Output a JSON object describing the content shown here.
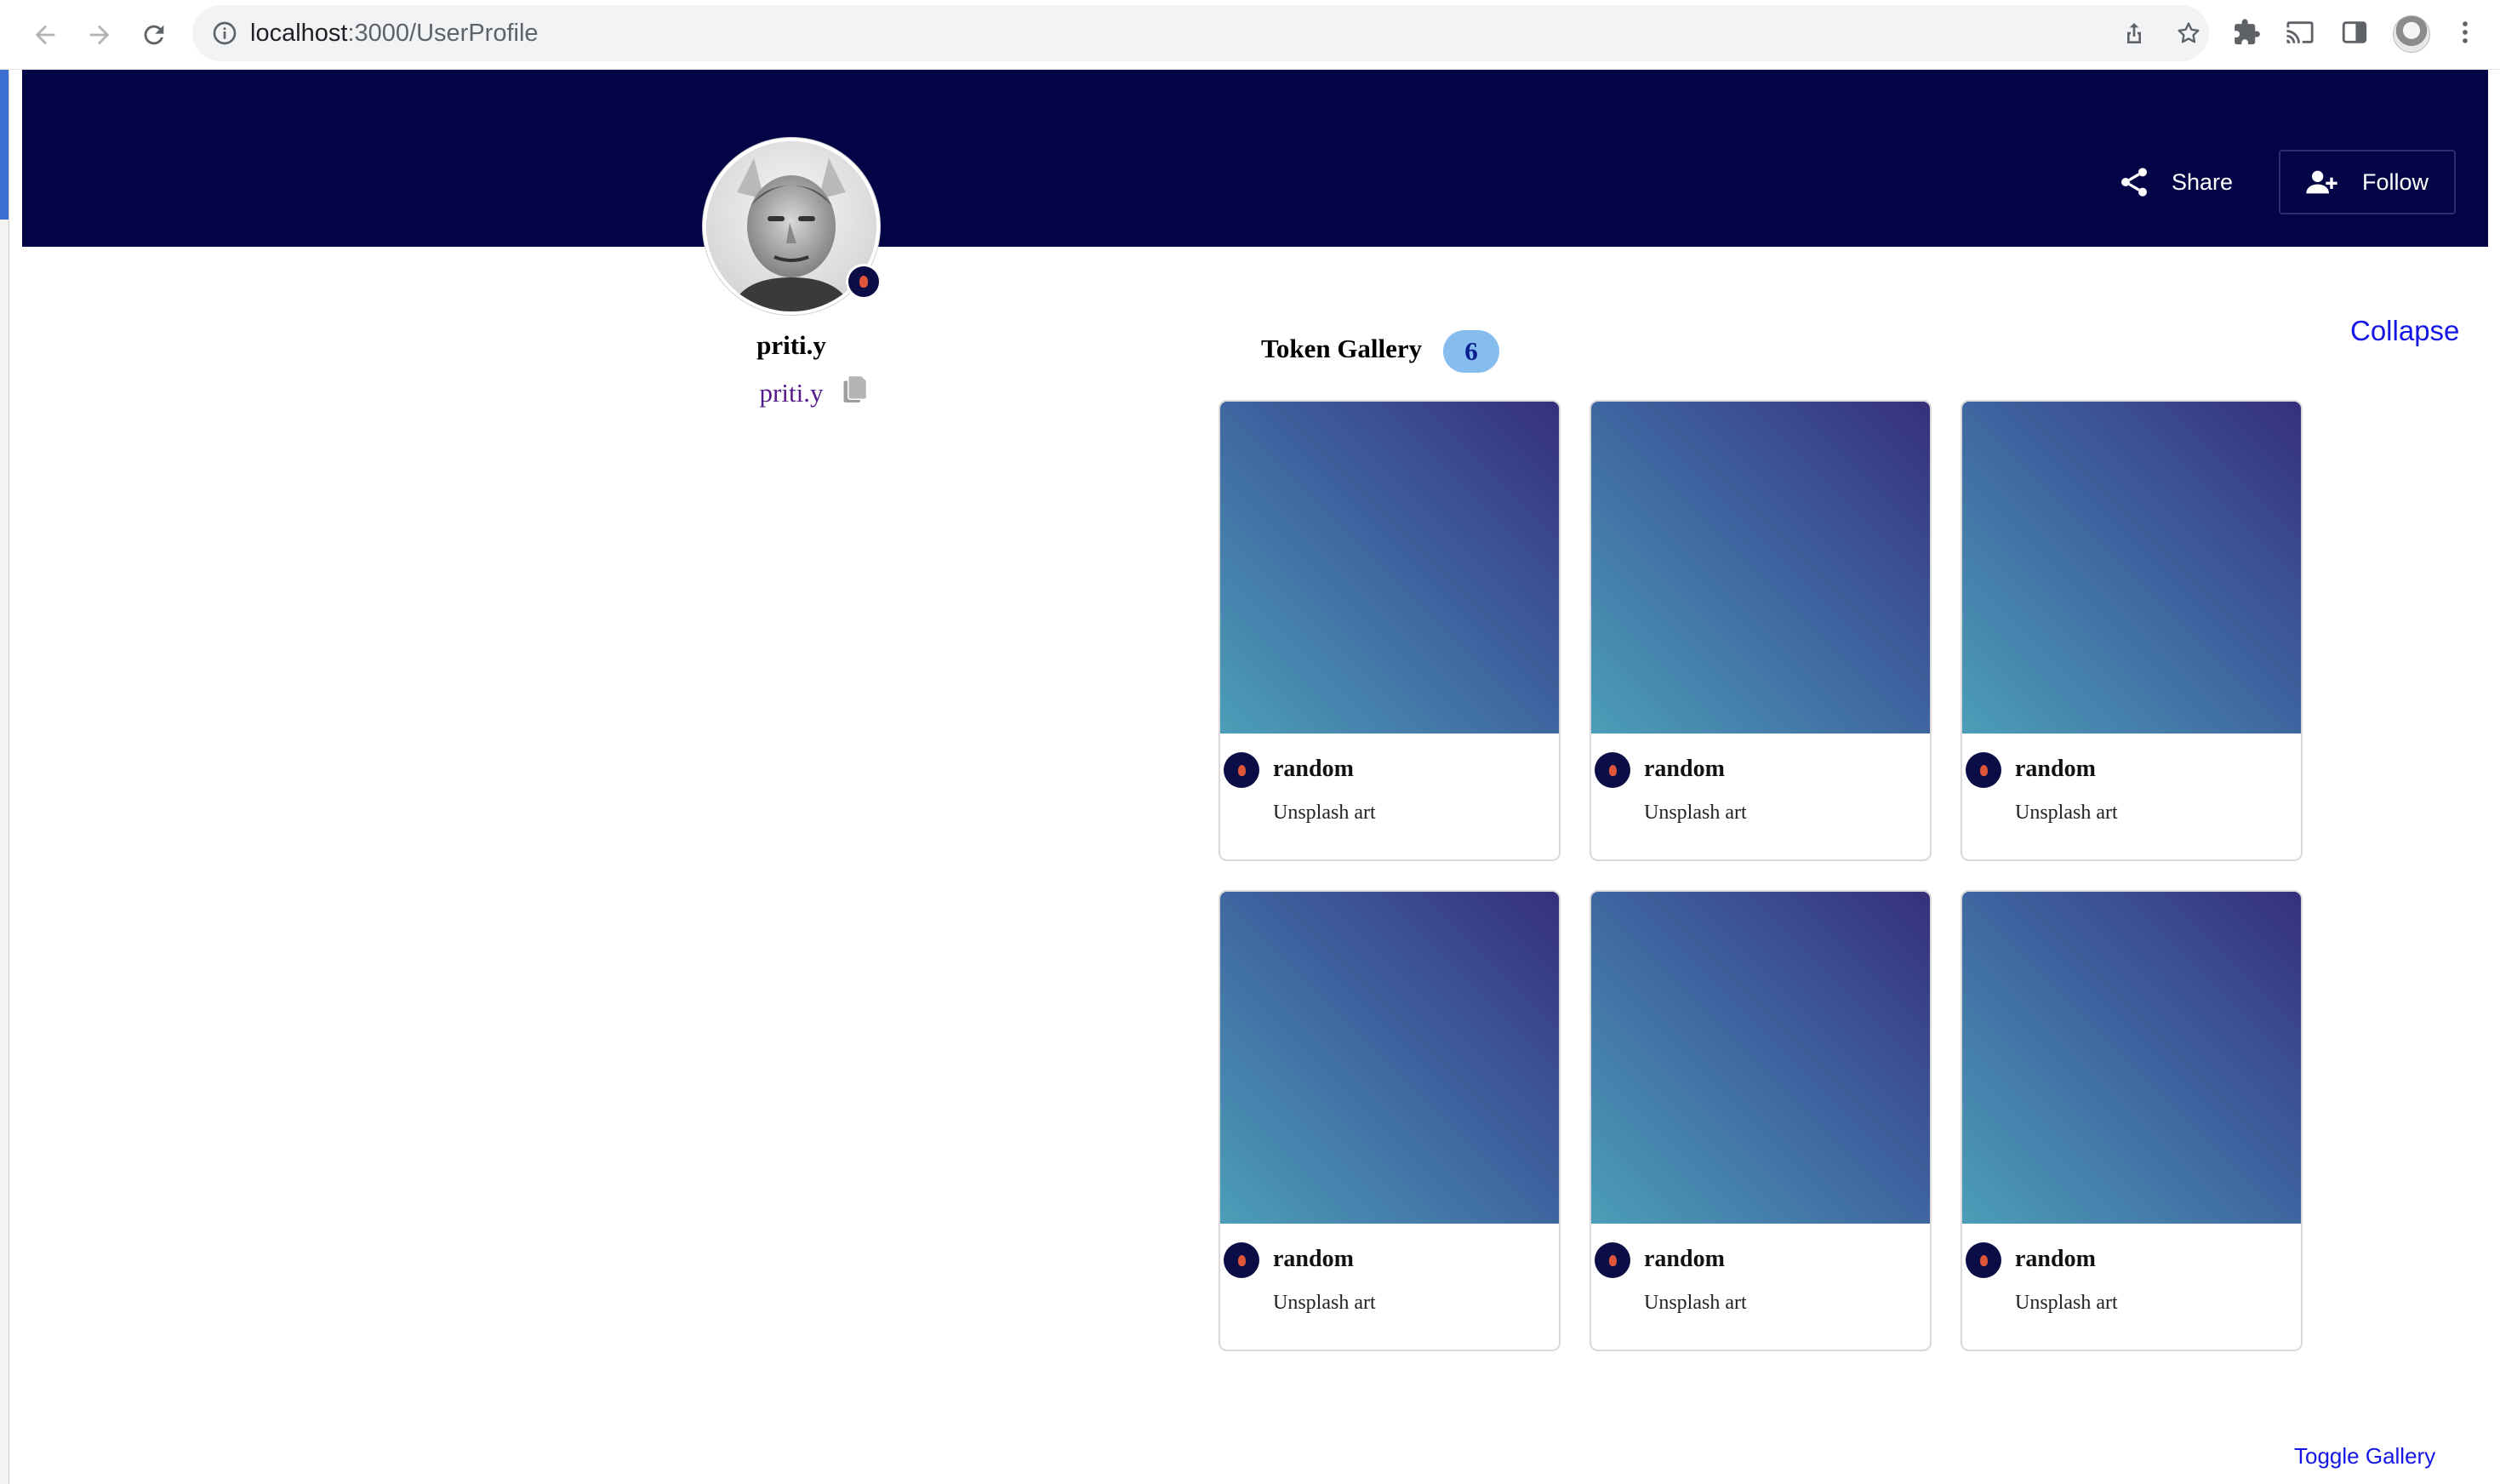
{
  "browser": {
    "url_host": "localhost",
    "url_path": ":3000/UserProfile"
  },
  "header": {
    "share_label": "Share",
    "follow_label": "Follow"
  },
  "profile": {
    "username": "priti.y",
    "handle": "priti.y"
  },
  "gallery": {
    "title": "Token Gallery",
    "count": "6",
    "collapse_label": "Collapse",
    "toggle_label": "Toggle Gallery",
    "cards": [
      {
        "name": "random",
        "subtitle": "Unsplash art"
      },
      {
        "name": "random",
        "subtitle": "Unsplash art"
      },
      {
        "name": "random",
        "subtitle": "Unsplash art"
      },
      {
        "name": "random",
        "subtitle": "Unsplash art"
      },
      {
        "name": "random",
        "subtitle": "Unsplash art"
      },
      {
        "name": "random",
        "subtitle": "Unsplash art"
      }
    ]
  },
  "colors": {
    "banner": "#020445",
    "link": "#1515e6",
    "handle": "#551a8b",
    "badge": "#86bdef"
  }
}
